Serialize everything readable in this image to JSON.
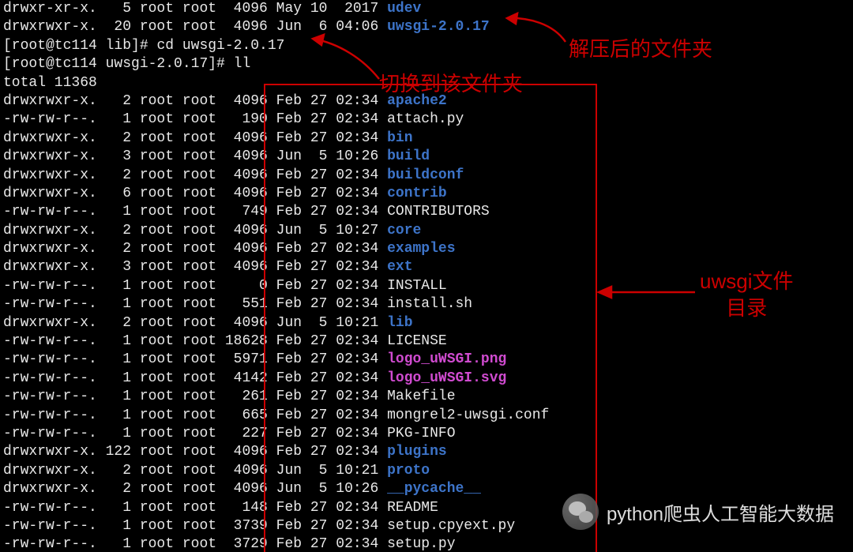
{
  "header_lines": [
    {
      "perm": "drwxr-xr-x.",
      "links": "5",
      "owner": "root",
      "group": "root",
      "size": "4096",
      "month": "May",
      "day": "10",
      "time": "2017",
      "name": "udev",
      "cls": "dir"
    },
    {
      "perm": "drwxrwxr-x.",
      "links": "20",
      "owner": "root",
      "group": "root",
      "size": "4096",
      "month": "Jun",
      "day": "6",
      "time": "04:06",
      "name": "uwsgi-2.0.17",
      "cls": "dir"
    }
  ],
  "prompts": [
    {
      "prefix": "[root@tc114 lib]# ",
      "cmd": "cd uwsgi-2.0.17"
    },
    {
      "prefix": "[root@tc114 uwsgi-2.0.17]# ",
      "cmd": "ll"
    }
  ],
  "total_line": "total 11368",
  "listing": [
    {
      "perm": "drwxrwxr-x.",
      "links": "2",
      "owner": "root",
      "group": "root",
      "size": "4096",
      "month": "Feb",
      "day": "27",
      "time": "02:34",
      "name": "apache2",
      "cls": "dir"
    },
    {
      "perm": "-rw-rw-r--.",
      "links": "1",
      "owner": "root",
      "group": "root",
      "size": "190",
      "month": "Feb",
      "day": "27",
      "time": "02:34",
      "name": "attach.py",
      "cls": "white"
    },
    {
      "perm": "drwxrwxr-x.",
      "links": "2",
      "owner": "root",
      "group": "root",
      "size": "4096",
      "month": "Feb",
      "day": "27",
      "time": "02:34",
      "name": "bin",
      "cls": "dir"
    },
    {
      "perm": "drwxrwxr-x.",
      "links": "3",
      "owner": "root",
      "group": "root",
      "size": "4096",
      "month": "Jun",
      "day": "5",
      "time": "10:26",
      "name": "build",
      "cls": "dir"
    },
    {
      "perm": "drwxrwxr-x.",
      "links": "2",
      "owner": "root",
      "group": "root",
      "size": "4096",
      "month": "Feb",
      "day": "27",
      "time": "02:34",
      "name": "buildconf",
      "cls": "dir"
    },
    {
      "perm": "drwxrwxr-x.",
      "links": "6",
      "owner": "root",
      "group": "root",
      "size": "4096",
      "month": "Feb",
      "day": "27",
      "time": "02:34",
      "name": "contrib",
      "cls": "dir"
    },
    {
      "perm": "-rw-rw-r--.",
      "links": "1",
      "owner": "root",
      "group": "root",
      "size": "749",
      "month": "Feb",
      "day": "27",
      "time": "02:34",
      "name": "CONTRIBUTORS",
      "cls": "white"
    },
    {
      "perm": "drwxrwxr-x.",
      "links": "2",
      "owner": "root",
      "group": "root",
      "size": "4096",
      "month": "Jun",
      "day": "5",
      "time": "10:27",
      "name": "core",
      "cls": "dir"
    },
    {
      "perm": "drwxrwxr-x.",
      "links": "2",
      "owner": "root",
      "group": "root",
      "size": "4096",
      "month": "Feb",
      "day": "27",
      "time": "02:34",
      "name": "examples",
      "cls": "dir"
    },
    {
      "perm": "drwxrwxr-x.",
      "links": "3",
      "owner": "root",
      "group": "root",
      "size": "4096",
      "month": "Feb",
      "day": "27",
      "time": "02:34",
      "name": "ext",
      "cls": "dir"
    },
    {
      "perm": "-rw-rw-r--.",
      "links": "1",
      "owner": "root",
      "group": "root",
      "size": "0",
      "month": "Feb",
      "day": "27",
      "time": "02:34",
      "name": "INSTALL",
      "cls": "white"
    },
    {
      "perm": "-rw-rw-r--.",
      "links": "1",
      "owner": "root",
      "group": "root",
      "size": "551",
      "month": "Feb",
      "day": "27",
      "time": "02:34",
      "name": "install.sh",
      "cls": "white"
    },
    {
      "perm": "drwxrwxr-x.",
      "links": "2",
      "owner": "root",
      "group": "root",
      "size": "4096",
      "month": "Jun",
      "day": "5",
      "time": "10:21",
      "name": "lib",
      "cls": "dir"
    },
    {
      "perm": "-rw-rw-r--.",
      "links": "1",
      "owner": "root",
      "group": "root",
      "size": "18628",
      "month": "Feb",
      "day": "27",
      "time": "02:34",
      "name": "LICENSE",
      "cls": "white"
    },
    {
      "perm": "-rw-rw-r--.",
      "links": "1",
      "owner": "root",
      "group": "root",
      "size": "5971",
      "month": "Feb",
      "day": "27",
      "time": "02:34",
      "name": "logo_uWSGI.png",
      "cls": "img"
    },
    {
      "perm": "-rw-rw-r--.",
      "links": "1",
      "owner": "root",
      "group": "root",
      "size": "4142",
      "month": "Feb",
      "day": "27",
      "time": "02:34",
      "name": "logo_uWSGI.svg",
      "cls": "img"
    },
    {
      "perm": "-rw-rw-r--.",
      "links": "1",
      "owner": "root",
      "group": "root",
      "size": "261",
      "month": "Feb",
      "day": "27",
      "time": "02:34",
      "name": "Makefile",
      "cls": "white"
    },
    {
      "perm": "-rw-rw-r--.",
      "links": "1",
      "owner": "root",
      "group": "root",
      "size": "665",
      "month": "Feb",
      "day": "27",
      "time": "02:34",
      "name": "mongrel2-uwsgi.conf",
      "cls": "white"
    },
    {
      "perm": "-rw-rw-r--.",
      "links": "1",
      "owner": "root",
      "group": "root",
      "size": "227",
      "month": "Feb",
      "day": "27",
      "time": "02:34",
      "name": "PKG-INFO",
      "cls": "white"
    },
    {
      "perm": "drwxrwxr-x.",
      "links": "122",
      "owner": "root",
      "group": "root",
      "size": "4096",
      "month": "Feb",
      "day": "27",
      "time": "02:34",
      "name": "plugins",
      "cls": "dir"
    },
    {
      "perm": "drwxrwxr-x.",
      "links": "2",
      "owner": "root",
      "group": "root",
      "size": "4096",
      "month": "Jun",
      "day": "5",
      "time": "10:21",
      "name": "proto",
      "cls": "dir"
    },
    {
      "perm": "drwxrwxr-x.",
      "links": "2",
      "owner": "root",
      "group": "root",
      "size": "4096",
      "month": "Jun",
      "day": "5",
      "time": "10:26",
      "name": "__pycache__",
      "cls": "dir"
    },
    {
      "perm": "-rw-rw-r--.",
      "links": "1",
      "owner": "root",
      "group": "root",
      "size": "148",
      "month": "Feb",
      "day": "27",
      "time": "02:34",
      "name": "README",
      "cls": "white"
    },
    {
      "perm": "-rw-rw-r--.",
      "links": "1",
      "owner": "root",
      "group": "root",
      "size": "3739",
      "month": "Feb",
      "day": "27",
      "time": "02:34",
      "name": "setup.cpyext.py",
      "cls": "white"
    },
    {
      "perm": "-rw-rw-r--.",
      "links": "1",
      "owner": "root",
      "group": "root",
      "size": "3729",
      "month": "Feb",
      "day": "27",
      "time": "02:34",
      "name": "setup.py",
      "cls": "white"
    }
  ],
  "annotations": {
    "annot1": "解压后的文件夹",
    "annot2": "切换到该文件夹",
    "annot3": "uwsgi文件\n目录"
  },
  "watermark": "python爬虫人工智能大数据"
}
